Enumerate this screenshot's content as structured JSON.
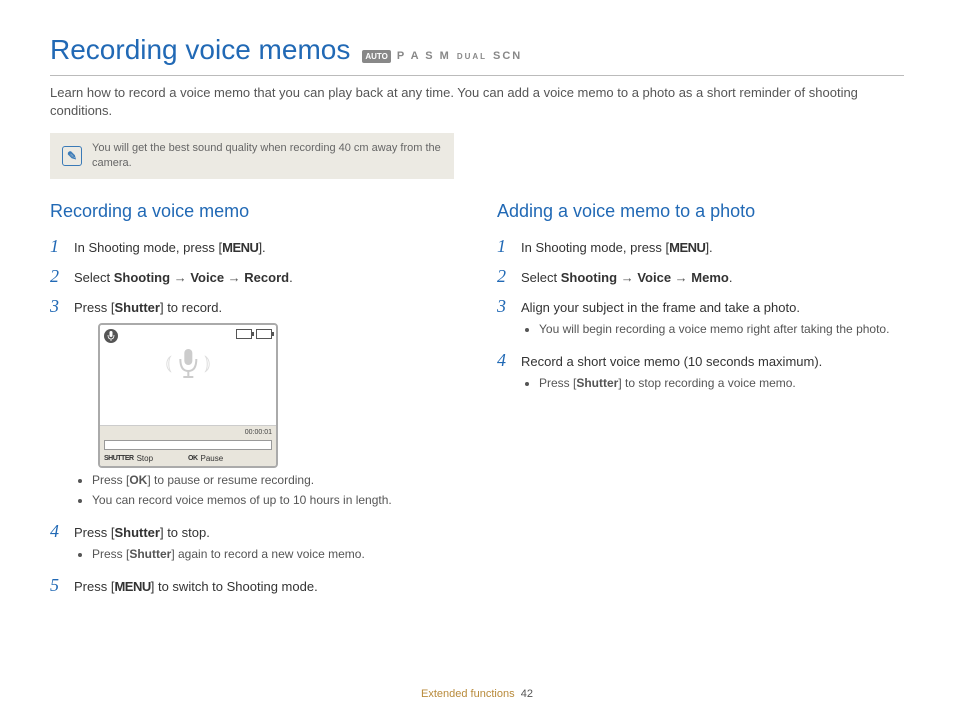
{
  "title": "Recording voice memos",
  "mode_bar": {
    "auto": "AUTO",
    "modes": "P A S M",
    "dual": "DUAL",
    "scn": "SCN"
  },
  "intro": "Learn how to record a voice memo that you can play back at any time. You can add a voice memo to a photo as a short reminder of shooting conditions.",
  "tip": "You will get the best sound quality when recording 40 cm away from the camera.",
  "left": {
    "heading": "Recording a voice memo",
    "steps": {
      "s1_pre": "In Shooting mode, press [",
      "s1_menu": "MENU",
      "s1_post": "].",
      "s2_pre": "Select ",
      "s2_shooting": "Shooting",
      "s2_voice": "Voice",
      "s2_record": "Record",
      "s2_post": ".",
      "s3_pre": "Press [",
      "s3_shutter": "Shutter",
      "s3_post": "] to record.",
      "s3_b1_pre": "Press [",
      "s3_b1_ok": "OK",
      "s3_b1_post": "] to pause or resume recording.",
      "s3_b2": "You can record voice memos of up to 10 hours in length.",
      "s4_pre": "Press [",
      "s4_shutter": "Shutter",
      "s4_post": "] to stop.",
      "s4_b1_pre": "Press [",
      "s4_b1_shutter": "Shutter",
      "s4_b1_post": "] again to record a new voice memo.",
      "s5_pre": "Press [",
      "s5_menu": "MENU",
      "s5_post": "] to switch to Shooting mode."
    },
    "lcd": {
      "time_left": "",
      "time_right": "00:00:01",
      "shutter_label": "SHUTTER",
      "stop": "Stop",
      "ok_label": "OK",
      "pause": "Pause"
    }
  },
  "right": {
    "heading": "Adding a voice memo to a photo",
    "steps": {
      "s1_pre": "In Shooting mode, press [",
      "s1_menu": "MENU",
      "s1_post": "].",
      "s2_pre": "Select ",
      "s2_shooting": "Shooting",
      "s2_voice": "Voice",
      "s2_memo": "Memo",
      "s2_post": ".",
      "s3": "Align your subject in the frame and take a photo.",
      "s3_b1": "You will begin recording a voice memo right after taking the photo.",
      "s4": "Record a short voice memo (10 seconds maximum).",
      "s4_b1_pre": "Press [",
      "s4_b1_shutter": "Shutter",
      "s4_b1_post": "] to stop recording a voice memo."
    }
  },
  "footer": {
    "section": "Extended functions",
    "page": "42"
  }
}
